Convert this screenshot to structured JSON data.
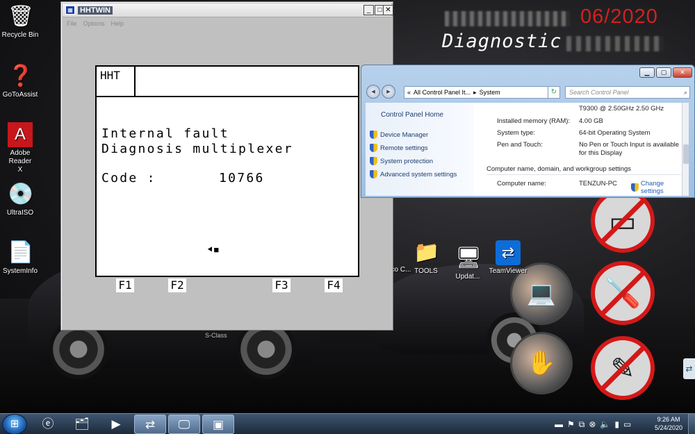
{
  "wallpaper": {
    "banner_date": "06/2020",
    "banner_title": "Diagnostic",
    "car_badge": "S-Class"
  },
  "desktop_icons": [
    {
      "label": "Recycle Bin",
      "icon": "recycle-bin-icon"
    },
    {
      "label": "GoToAssist",
      "icon": "gotoassist-icon"
    },
    {
      "label": "Adobe Reader X",
      "icon": "adobe-reader-icon"
    },
    {
      "label": "UltraISO",
      "icon": "ultraiso-icon"
    },
    {
      "label": "SystemInfo",
      "icon": "document-icon"
    },
    {
      "label": "TOOLS",
      "icon": "folder-icon"
    },
    {
      "label": "Updat...",
      "icon": "update-icon"
    },
    {
      "label": "TeamViewer",
      "icon": "teamviewer-icon"
    },
    {
      "label": "...aco C...",
      "icon": "shortcut-icon"
    }
  ],
  "hhtwin": {
    "title": "HHTWIN",
    "menu": [
      "File",
      "Options",
      "Help"
    ],
    "header_label": "HHT",
    "line1": "Internal fault",
    "line2": "Diagnosis multiplexer",
    "code_label": "Code :",
    "code_value": "10766",
    "function_keys": [
      "F1",
      "F2",
      "F3",
      "F4"
    ],
    "window_controls": {
      "minimize": "_",
      "maximize": "□",
      "close": "✕"
    }
  },
  "control_panel": {
    "address_prefix": "«",
    "address_path": "All Control Panel It...",
    "address_sep": "▸",
    "address_current": "System",
    "search_placeholder": "Search Control Panel",
    "home_link": "Control Panel Home",
    "tasks": [
      "Device Manager",
      "Remote settings",
      "System protection",
      "Advanced system settings"
    ],
    "processor_value": "T9300  @ 2.50GHz   2.50 GHz",
    "rows": [
      {
        "label": "Installed memory (RAM):",
        "value": "4.00 GB"
      },
      {
        "label": "System type:",
        "value": "64-bit Operating System"
      },
      {
        "label": "Pen and Touch:",
        "value": "No Pen or Touch Input is available for this Display"
      }
    ],
    "section_heading": "Computer name, domain, and workgroup settings",
    "computer_name_label": "Computer name:",
    "computer_name_value": "TENZUN-PC",
    "change_settings": "Change settings"
  },
  "taskbar": {
    "clock_time": "9:26 AM",
    "clock_date": "5/24/2020",
    "pinned": [
      "ie-icon",
      "explorer-icon",
      "media-player-icon",
      "teamviewer-icon",
      "remote-desktop-icon",
      "control-panel-icon"
    ]
  },
  "colors": {
    "banner_red": "#d42020",
    "hht_bg": "#c0c0c0",
    "cp_link": "#1d3d70",
    "taskbar": "#1d2b3b"
  }
}
